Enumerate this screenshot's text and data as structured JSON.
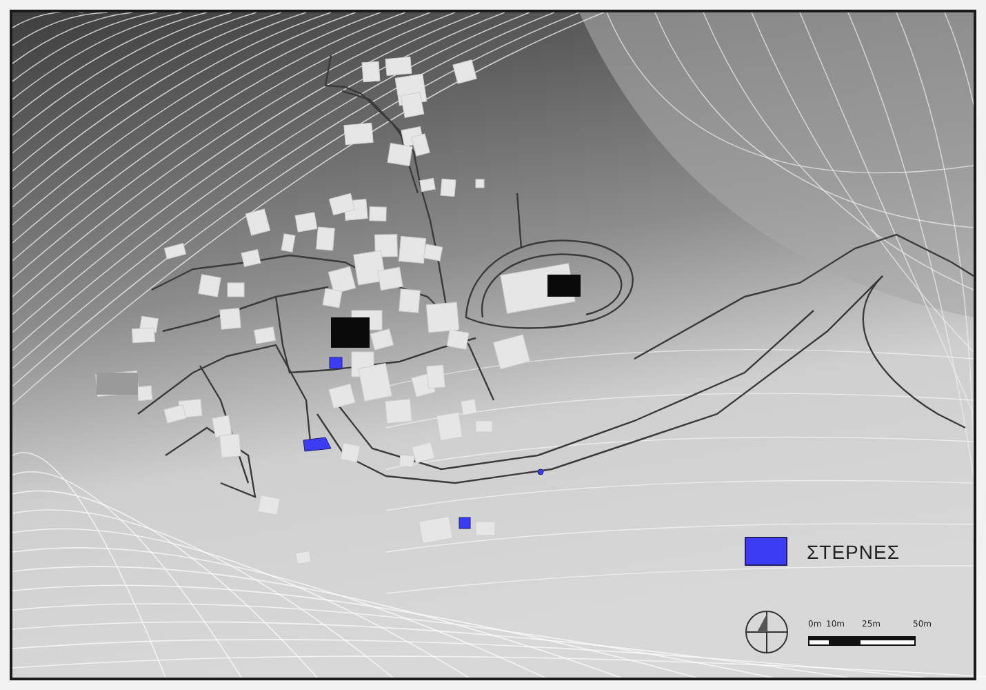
{
  "legend": [
    {
      "label": "ΣΤΕΡΝΕΣ",
      "color": "#3c3cf5"
    }
  ],
  "scale_bar": {
    "labels": [
      "0m",
      "10m",
      "25m",
      "50m"
    ]
  }
}
